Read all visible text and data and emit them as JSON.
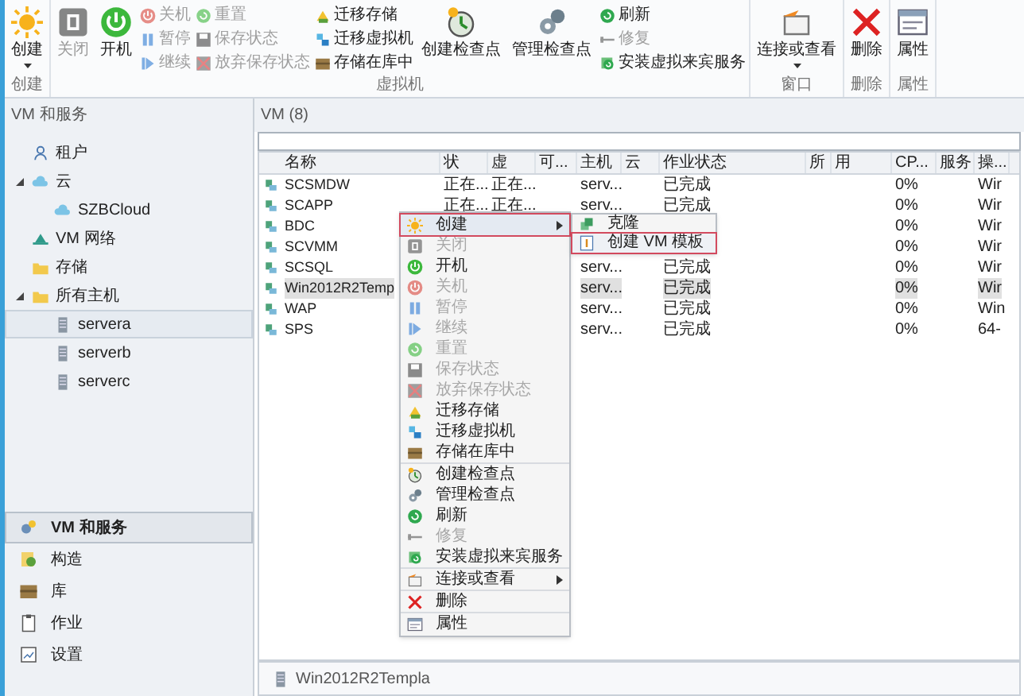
{
  "ribbon": {
    "groups": [
      {
        "label": "创建",
        "large": [
          {
            "label": "创建",
            "disabled": false,
            "dropdown": true
          }
        ]
      },
      {
        "label": "虚拟机",
        "large": [
          {
            "label": "关闭",
            "disabled": true,
            "dropdown": false
          },
          {
            "label": "开机",
            "disabled": false,
            "dropdown": false
          }
        ],
        "small_columns": [
          [
            {
              "label": "关机",
              "disabled": true
            },
            {
              "label": "暂停",
              "disabled": true
            },
            {
              "label": "继续",
              "disabled": true
            }
          ],
          [
            {
              "label": "重置",
              "disabled": true
            },
            {
              "label": "保存状态",
              "disabled": true
            },
            {
              "label": "放弃保存状态",
              "disabled": true
            }
          ],
          [
            {
              "label": "迁移存储",
              "disabled": false
            },
            {
              "label": "迁移虚拟机",
              "disabled": false
            },
            {
              "label": "存储在库中",
              "disabled": false
            }
          ]
        ],
        "after": [
          {
            "label": "创建检查点",
            "disabled": false,
            "dropdown": false
          },
          {
            "label": "管理检查点",
            "disabled": false,
            "dropdown": false
          }
        ],
        "after_small": [
          {
            "label": "刷新",
            "disabled": false
          },
          {
            "label": "修复",
            "disabled": true
          },
          {
            "label": "安装虚拟来宾服务",
            "disabled": false
          }
        ]
      },
      {
        "label": "窗口",
        "large": [
          {
            "label": "连接或查看",
            "disabled": false,
            "dropdown": true
          }
        ]
      },
      {
        "label": "删除",
        "large": [
          {
            "label": "删除",
            "disabled": false,
            "dropdown": false
          }
        ]
      },
      {
        "label": "属性",
        "large": [
          {
            "label": "属性",
            "disabled": false,
            "dropdown": false
          }
        ]
      }
    ]
  },
  "sidebar": {
    "title": "VM 和服务",
    "tree": [
      {
        "label": "租户",
        "selected": false
      },
      {
        "label": "云",
        "selected": false,
        "expanded": true,
        "children": [
          {
            "label": "SZBCloud",
            "selected": false
          }
        ]
      },
      {
        "label": "VM 网络",
        "selected": false
      },
      {
        "label": "存储",
        "selected": false
      },
      {
        "label": "所有主机",
        "selected": false,
        "expanded": true,
        "children": [
          {
            "label": "servera",
            "selected": true
          },
          {
            "label": "serverb",
            "selected": false
          },
          {
            "label": "serverc",
            "selected": false
          }
        ]
      }
    ],
    "nav": [
      {
        "label": "VM 和服务",
        "selected": true
      },
      {
        "label": "构造",
        "selected": false
      },
      {
        "label": "库",
        "selected": false
      },
      {
        "label": "作业",
        "selected": false
      },
      {
        "label": "设置",
        "selected": false
      }
    ]
  },
  "main": {
    "title": "VM (8)",
    "table": {
      "columns": [
        "名称",
        "状",
        "虚",
        "可...",
        "主机",
        "云",
        "作业状态",
        "所",
        "用",
        "CP...",
        "服务",
        "操..."
      ],
      "rows": [
        {
          "name": "SCSMDW",
          "state": "正在...",
          "vm_state": "正在...",
          "host": "serv...",
          "job": "已完成",
          "cpu": "0%",
          "os": "Wir",
          "selected": false
        },
        {
          "name": "SCAPP",
          "state": "正在...",
          "vm_state": "正在...",
          "host": "serv...",
          "job": "已完成",
          "cpu": "0%",
          "os": "Wir",
          "selected": false
        },
        {
          "name": "BDC",
          "cpu": "0%",
          "os": "Wir",
          "selected": false
        },
        {
          "name": "SCVMM",
          "cpu": "0%",
          "os": "Wir",
          "selected": false
        },
        {
          "name": "SCSQL",
          "host": "serv...",
          "job": "已完成",
          "cpu": "0%",
          "os": "Wir",
          "selected": false
        },
        {
          "name": "Win2012R2Temp",
          "host": "serv...",
          "job": "已完成",
          "cpu": "0%",
          "os": "Wir",
          "selected": true
        },
        {
          "name": "WAP",
          "host": "serv...",
          "job": "已完成",
          "cpu": "0%",
          "os": "Win",
          "selected": false
        },
        {
          "name": "SPS",
          "host": "serv...",
          "job": "已完成",
          "cpu": "0%",
          "os": "64-",
          "selected": false
        }
      ]
    },
    "details": {
      "name": "Win2012R2Templa"
    }
  },
  "context_menu": {
    "groups": [
      [
        {
          "label": "创建",
          "disabled": false,
          "submenu": true,
          "highlighted": true
        },
        {
          "label": "关闭",
          "disabled": true
        },
        {
          "label": "开机",
          "disabled": false
        },
        {
          "label": "关机",
          "disabled": true
        },
        {
          "label": "暂停",
          "disabled": true
        },
        {
          "label": "继续",
          "disabled": true
        },
        {
          "label": "重置",
          "disabled": true
        },
        {
          "label": "保存状态",
          "disabled": true
        },
        {
          "label": "放弃保存状态",
          "disabled": true
        },
        {
          "label": "迁移存储",
          "disabled": false
        },
        {
          "label": "迁移虚拟机",
          "disabled": false
        },
        {
          "label": "存储在库中",
          "disabled": false
        }
      ],
      [
        {
          "label": "创建检查点",
          "disabled": false
        },
        {
          "label": "管理检查点",
          "disabled": false
        },
        {
          "label": "刷新",
          "disabled": false
        },
        {
          "label": "修复",
          "disabled": true
        },
        {
          "label": "安装虚拟来宾服务",
          "disabled": false
        }
      ],
      [
        {
          "label": "连接或查看",
          "disabled": false,
          "submenu": true
        }
      ],
      [
        {
          "label": "删除",
          "disabled": false
        }
      ],
      [
        {
          "label": "属性",
          "disabled": false
        }
      ]
    ],
    "submenu": [
      {
        "label": "克隆",
        "highlighted": false
      },
      {
        "label": "创建 VM 模板",
        "highlighted": true
      }
    ]
  }
}
